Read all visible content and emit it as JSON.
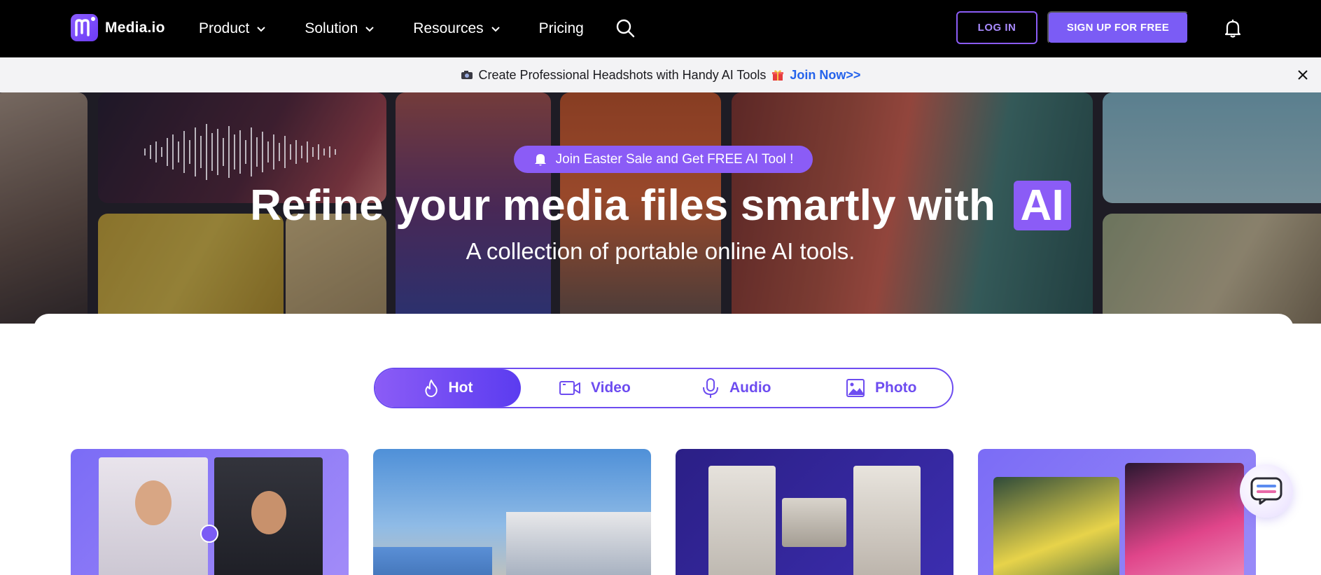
{
  "brand": {
    "name": "Media.io"
  },
  "nav": {
    "items": [
      {
        "label": "Product",
        "has_dropdown": true
      },
      {
        "label": "Solution",
        "has_dropdown": true
      },
      {
        "label": "Resources",
        "has_dropdown": true
      },
      {
        "label": "Pricing",
        "has_dropdown": false
      }
    ],
    "login_label": "LOG IN",
    "signup_label": "SIGN UP FOR FREE"
  },
  "promo": {
    "text": "Create Professional Headshots with Handy AI Tools",
    "link_label": "Join Now>>"
  },
  "hero": {
    "sale_label": "Join Easter Sale and Get FREE AI Tool !",
    "title": "Refine your media files smartly with",
    "title_highlight": "AI",
    "subtitle": "A collection of portable online AI tools."
  },
  "tabs": [
    {
      "label": "Hot",
      "icon": "flame-icon",
      "active": true
    },
    {
      "label": "Video",
      "icon": "video-icon",
      "active": false
    },
    {
      "label": "Audio",
      "icon": "microphone-icon",
      "active": false
    },
    {
      "label": "Photo",
      "icon": "image-icon",
      "active": false
    }
  ],
  "colors": {
    "accent": "#8b5cf6",
    "accent_dark": "#6d4cf0",
    "nav_bg": "#000000",
    "promo_bg": "#f3f3f5",
    "link_blue": "#2563eb"
  }
}
